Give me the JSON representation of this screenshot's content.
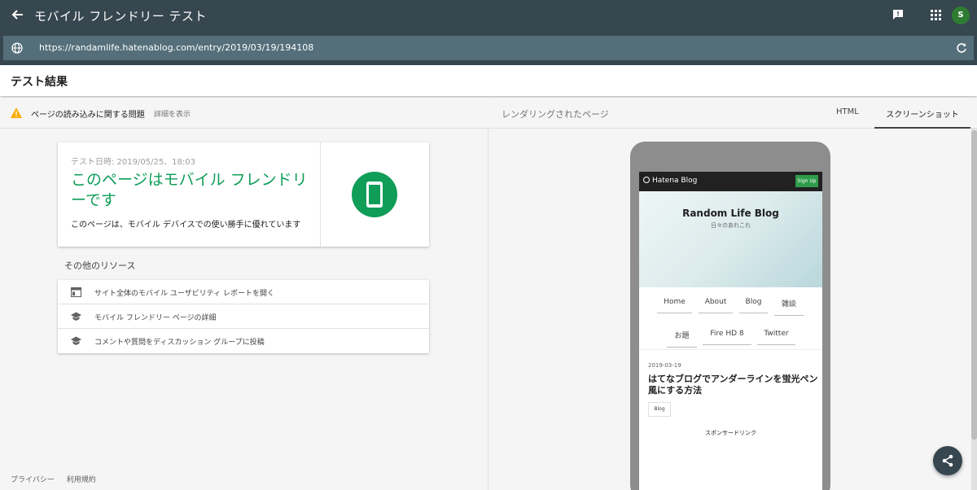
{
  "topbar": {
    "title": "モバイル フレンドリー テスト",
    "avatar_letter": "S",
    "icons": [
      "back-arrow-icon",
      "feedback-icon",
      "apps-grid-icon"
    ]
  },
  "urlbar": {
    "url": "https://randamlife.hatenablog.com/entry/2019/03/19/194108",
    "icons": [
      "globe-icon",
      "refresh-icon"
    ]
  },
  "results": {
    "heading": "テスト結果"
  },
  "issue": {
    "text": "ページの読み込みに関する問題",
    "link": "詳細を表示"
  },
  "card": {
    "date": "テスト日時: 2019/05/25、18:03",
    "headline": "このページはモバイル フレンドリーです",
    "sub": "このページは、モバイル デバイスでの使い勝手に優れています",
    "accent_color": "#0f9d58"
  },
  "resources": {
    "title": "その他のリソース",
    "items": [
      {
        "label": "サイト全体のモバイル ユーザビリティ レポートを開く",
        "icon": "report-icon"
      },
      {
        "label": "モバイル フレンドリー ページの詳細",
        "icon": "school-icon"
      },
      {
        "label": "コメントや質問をディスカッション グループに投稿",
        "icon": "school-icon"
      }
    ]
  },
  "footer": {
    "privacy": "プライバシー",
    "terms": "利用規約"
  },
  "rendered": {
    "label": "レンダリングされたページ",
    "tabs": {
      "html": "HTML",
      "screenshot": "スクリーンショット"
    }
  },
  "preview": {
    "brand": "Hatena Blog",
    "signup": "Sign Up",
    "blog_title": "Random Life Blog",
    "blog_subtitle": "日々のあれこれ",
    "nav_row1": [
      "Home",
      "About",
      "Blog",
      "雑談"
    ],
    "nav_row2": [
      "お題",
      "Fire HD 8",
      "Twitter"
    ],
    "post_date": "2019-03-19",
    "post_title": "はてなブログでアンダーラインを蛍光ペン風にする方法",
    "post_tag": "Blog",
    "sponsor": "スポンサードリンク"
  }
}
